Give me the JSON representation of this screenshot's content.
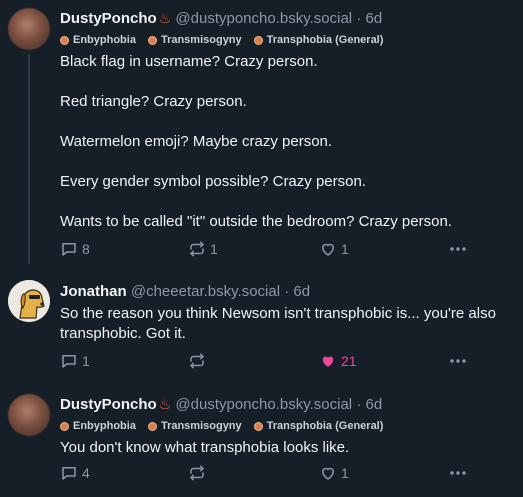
{
  "posts": [
    {
      "display_name": "DustyPoncho",
      "badge": "♨",
      "handle": "@dustyponcho.bsky.social",
      "sep": "·",
      "time": "6d",
      "labels": [
        "Enbyphobia",
        "Transmisogyny",
        "Transphobia (General)"
      ],
      "text": "Black flag in username? Crazy person.\n\nRed triangle? Crazy person.\n\nWatermelon emoji? Maybe crazy person.\n\nEvery gender symbol possible? Crazy person.\n\nWants to be called \"it\" outside the bedroom? Crazy person.",
      "replies": "8",
      "reposts": "1",
      "likes": "1"
    },
    {
      "display_name": "Jonathan",
      "handle": "@cheeetar.bsky.social",
      "sep": "·",
      "time": "6d",
      "text": "So the reason you think Newsom isn't transphobic is... you're also\ntransphobic. Got it.",
      "replies": "1",
      "reposts": "",
      "likes": "21",
      "liked": true
    },
    {
      "display_name": "DustyPoncho",
      "badge": "♨",
      "handle": "@dustyponcho.bsky.social",
      "sep": "·",
      "time": "6d",
      "labels": [
        "Enbyphobia",
        "Transmisogyny",
        "Transphobia (General)"
      ],
      "text": "You don't know what transphobia looks like.",
      "replies": "4",
      "reposts": "",
      "likes": "1"
    }
  ],
  "colors": {
    "background": "#161e27",
    "like_active": "#ec4899",
    "muted": "#8b98a5"
  },
  "icons": [
    "reply-icon",
    "repost-icon",
    "like-icon",
    "more-icon"
  ]
}
